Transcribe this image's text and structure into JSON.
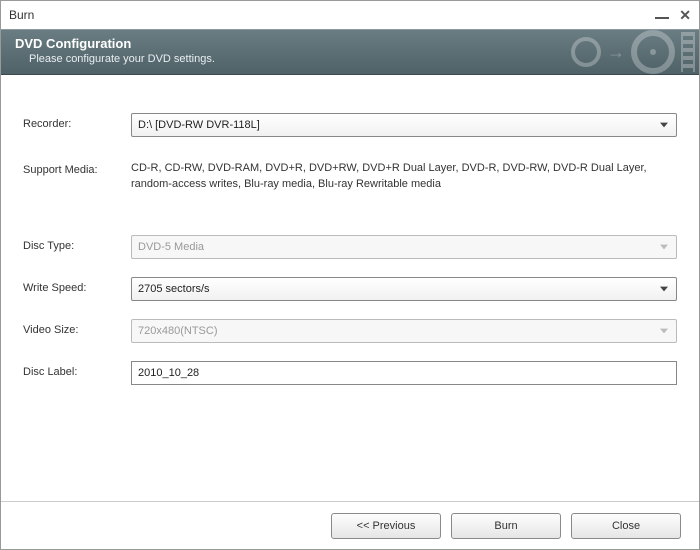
{
  "window": {
    "title": "Burn"
  },
  "header": {
    "title": "DVD Configuration",
    "subtitle": "Please configurate your DVD settings."
  },
  "labels": {
    "recorder": "Recorder:",
    "support_media": "Support Media:",
    "disc_type": "Disc Type:",
    "write_speed": "Write Speed:",
    "video_size": "Video Size:",
    "disc_label": "Disc Label:"
  },
  "fields": {
    "recorder": "D:\\ [DVD-RW  DVR-118L]",
    "support_media": "CD-R, CD-RW, DVD-RAM, DVD+R, DVD+RW, DVD+R Dual Layer, DVD-R, DVD-RW, DVD-R Dual Layer, random-access writes, Blu-ray media, Blu-ray Rewritable media",
    "disc_type": "DVD-5 Media",
    "write_speed": "2705 sectors/s",
    "video_size": "720x480(NTSC)",
    "disc_label": "2010_10_28"
  },
  "footer": {
    "previous": "<< Previous",
    "burn": "Burn",
    "close": "Close"
  }
}
